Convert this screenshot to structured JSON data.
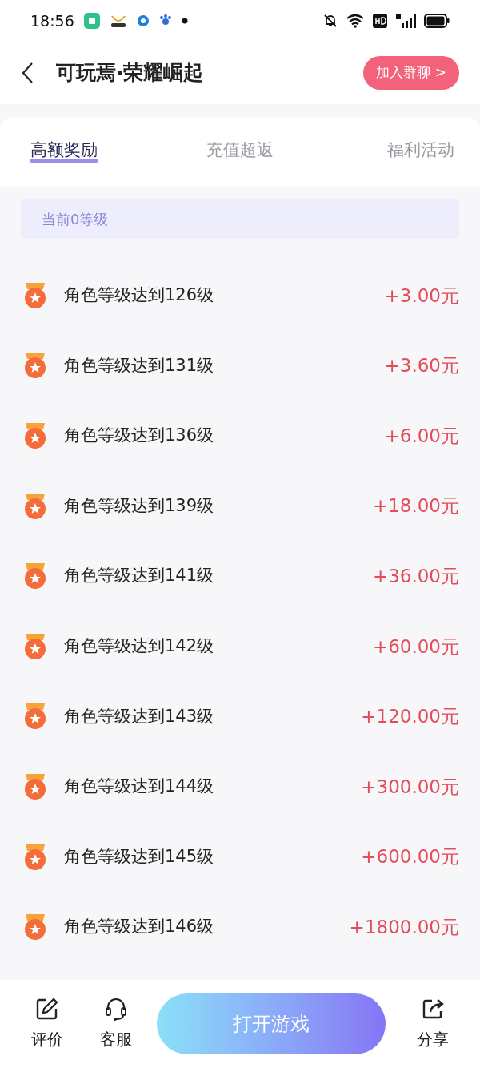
{
  "status_bar": {
    "time": "18:56"
  },
  "header": {
    "title": "可玩焉·荣耀崛起",
    "join_button": "加入群聊 >"
  },
  "tabs": [
    {
      "label": "高额奖励",
      "selected": true
    },
    {
      "label": "充值超返",
      "selected": false
    },
    {
      "label": "福利活动",
      "selected": false
    }
  ],
  "level_banner": "当前0等级",
  "rewards": [
    {
      "label": "角色等级达到126级",
      "amount": "+3.00元"
    },
    {
      "label": "角色等级达到131级",
      "amount": "+3.60元"
    },
    {
      "label": "角色等级达到136级",
      "amount": "+6.00元"
    },
    {
      "label": "角色等级达到139级",
      "amount": "+18.00元"
    },
    {
      "label": "角色等级达到141级",
      "amount": "+36.00元"
    },
    {
      "label": "角色等级达到142级",
      "amount": "+60.00元"
    },
    {
      "label": "角色等级达到143级",
      "amount": "+120.00元"
    },
    {
      "label": "角色等级达到144级",
      "amount": "+300.00元"
    },
    {
      "label": "角色等级达到145级",
      "amount": "+600.00元"
    },
    {
      "label": "角色等级达到146级",
      "amount": "+1800.00元"
    }
  ],
  "bottom_bar": {
    "review": "评价",
    "service": "客服",
    "open_button": "打开游戏",
    "share": "分享"
  }
}
